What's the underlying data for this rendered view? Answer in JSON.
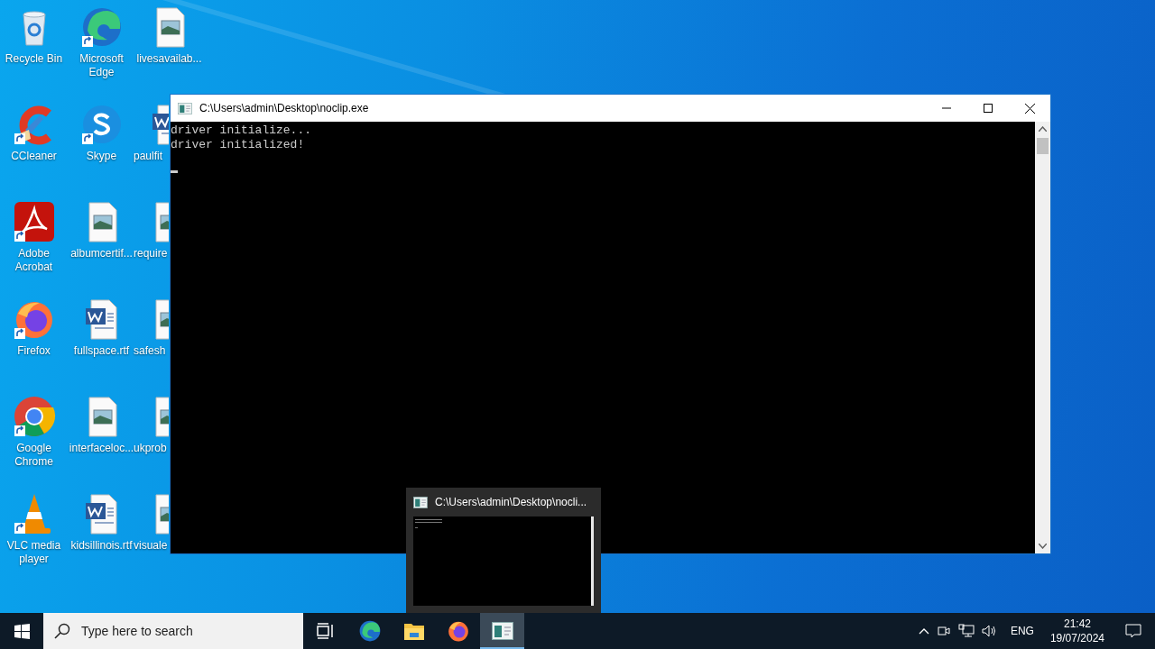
{
  "desktop_icons": [
    {
      "label": "Recycle Bin",
      "kind": "recycle",
      "shortcut": false
    },
    {
      "label": "CCleaner",
      "kind": "ccleaner",
      "shortcut": true
    },
    {
      "label": "Adobe Acrobat",
      "kind": "acrobat",
      "shortcut": true
    },
    {
      "label": "Firefox",
      "kind": "firefox",
      "shortcut": true
    },
    {
      "label": "Google Chrome",
      "kind": "chrome",
      "shortcut": true
    },
    {
      "label": "VLC media player",
      "kind": "vlc",
      "shortcut": true
    },
    {
      "label": "Microsoft Edge",
      "kind": "edge",
      "shortcut": true
    },
    {
      "label": "Skype",
      "kind": "skype",
      "shortcut": true
    },
    {
      "label": "albumcertif...",
      "kind": "image",
      "shortcut": false
    },
    {
      "label": "fullspace.rtf",
      "kind": "word",
      "shortcut": false
    },
    {
      "label": "interfaceloc...",
      "kind": "image",
      "shortcut": false
    },
    {
      "label": "kidsillinois.rtf",
      "kind": "word",
      "shortcut": false
    },
    {
      "label": "livesavailab...",
      "kind": "image",
      "shortcut": false
    },
    {
      "label": "paulfit",
      "kind": "word",
      "shortcut": false
    },
    {
      "label": "require",
      "kind": "image",
      "shortcut": false
    },
    {
      "label": "safesh",
      "kind": "image",
      "shortcut": false
    },
    {
      "label": "ukprob",
      "kind": "image",
      "shortcut": false
    },
    {
      "label": "visuale",
      "kind": "image",
      "shortcut": false
    }
  ],
  "console_window": {
    "title": "C:\\Users\\admin\\Desktop\\noclip.exe",
    "lines": [
      "driver initialize...",
      "driver initialized!"
    ]
  },
  "taskbar_preview": {
    "title": "C:\\Users\\admin\\Desktop\\nocli..."
  },
  "taskbar": {
    "search": {
      "placeholder": "Type here to search"
    },
    "apps": [
      {
        "kind": "taskview",
        "selected": false
      },
      {
        "kind": "edge",
        "selected": false
      },
      {
        "kind": "explorer",
        "selected": false
      },
      {
        "kind": "firefox",
        "selected": false
      },
      {
        "kind": "console",
        "selected": true
      }
    ],
    "language": "ENG",
    "time": "21:42",
    "date": "19/07/2024"
  }
}
